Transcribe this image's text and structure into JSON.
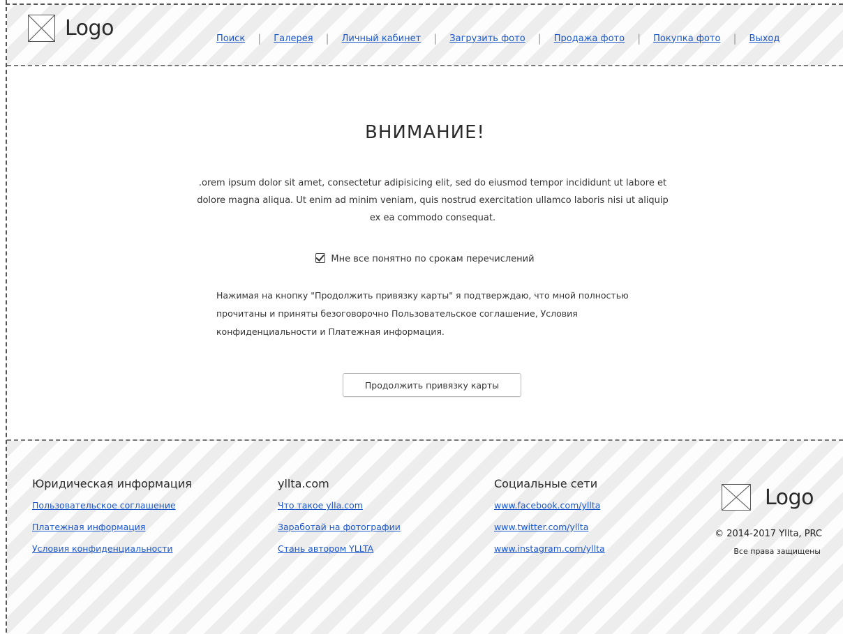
{
  "header": {
    "logo_text": "Logo",
    "nav": [
      {
        "label": "Поиск"
      },
      {
        "label": "Галерея"
      },
      {
        "label": "Личный кабинет"
      },
      {
        "label": "Загрузить фото"
      },
      {
        "label": "Продажа фото"
      },
      {
        "label": "Покупка фото"
      },
      {
        "label": "Выход"
      }
    ],
    "separator": "|"
  },
  "main": {
    "title": "ВНИМАНИЕ!",
    "lorem": ".orem ipsum dolor sit amet, consectetur adipisicing elit, sed do eiusmod tempor incididunt ut labore et dolore magna aliqua. Ut enim ad minim veniam, quis nostrud exercitation ullamco laboris nisi ut aliquip ex ea commodo consequat.",
    "checkbox_label": "Мне все понятно по срокам перечислений",
    "checkbox_checked": true,
    "notice": "Нажимая на кнопку \"Продолжить привязку карты\" я подтверждаю, что мной полностью прочитаны и приняты безоговорочно Пользовательское соглашение, Условия конфиденциальности и Платежная информация.",
    "button_label": "Продолжить привязку карты"
  },
  "footer": {
    "legal": {
      "heading": "Юридическая информация",
      "links": [
        "Пользовательское соглашение",
        "Платежная информация",
        "Условия конфиденциальности"
      ]
    },
    "site": {
      "heading": "yllta.com",
      "links": [
        "Что такое ylla.com",
        "Заработай на фотографии",
        "Стань автором YLLTA"
      ]
    },
    "social": {
      "heading": "Социальные сети",
      "links": [
        "www.facebook.com/yllta",
        "www.twitter.com/yllta",
        "www.instagram.com/yllta"
      ]
    },
    "logo_text": "Logo",
    "copyright": "© 2014-2017 Yllta, PRC",
    "rights": "Все права защищены"
  },
  "colors": {
    "link": "#1a56c9",
    "text": "#222222",
    "background": "#ffffff"
  }
}
